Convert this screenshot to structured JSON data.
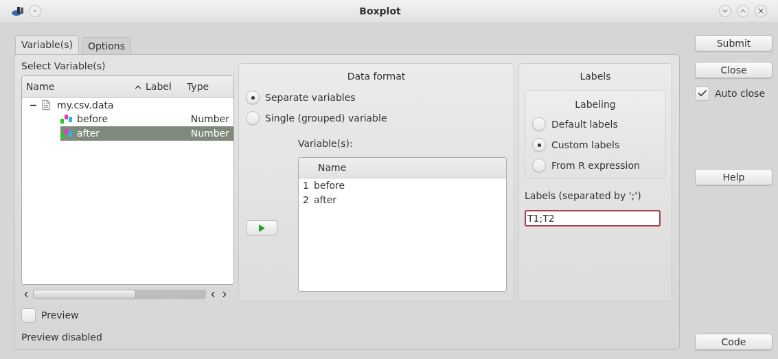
{
  "window": {
    "title": "Boxplot"
  },
  "tabs": [
    {
      "label": "Variable(s)",
      "selected": true
    },
    {
      "label": "Options",
      "selected": false
    }
  ],
  "select_variables": {
    "title": "Select Variable(s)",
    "columns": [
      {
        "label": "Name",
        "sorted": true
      },
      {
        "label": "Label",
        "sorted": false
      },
      {
        "label": "Type",
        "sorted": false
      }
    ],
    "items": [
      {
        "name": "my.csv.data",
        "expanded": true,
        "children": [
          {
            "name": "before",
            "type": "Number",
            "selected": false
          },
          {
            "name": "after",
            "type": "Number",
            "selected": true
          }
        ]
      }
    ]
  },
  "preview": {
    "label": "Preview",
    "checked": false,
    "status": "Preview disabled"
  },
  "data_format": {
    "title": "Data format",
    "options": [
      {
        "label": "Separate variables",
        "selected": true
      },
      {
        "label": "Single (grouped) variable",
        "selected": false
      }
    ],
    "variables_label": "Variable(s):",
    "variables_column": "Name",
    "variables": [
      {
        "index": "1",
        "name": "before"
      },
      {
        "index": "2",
        "name": "after"
      }
    ]
  },
  "labels": {
    "title": "Labels",
    "labeling_title": "Labeling",
    "options": [
      {
        "label": "Default labels",
        "selected": false
      },
      {
        "label": "Custom labels",
        "selected": true
      },
      {
        "label": "From R expression",
        "selected": false
      }
    ],
    "field_label": "Labels (separated by ';')",
    "field_value": "T1;T2",
    "focused": true
  },
  "buttons": {
    "submit": "Submit",
    "close": "Close",
    "help": "Help",
    "code": "Code"
  },
  "auto_close": {
    "label": "Auto close",
    "checked": true
  }
}
